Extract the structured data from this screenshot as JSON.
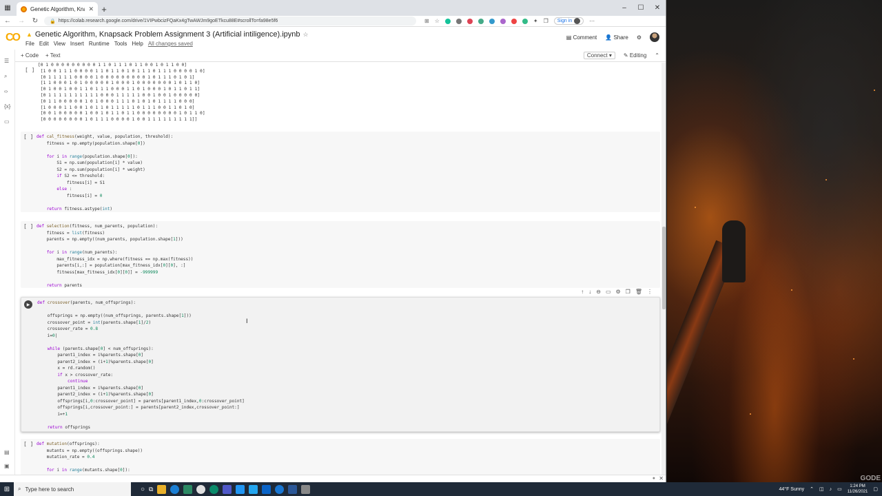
{
  "browser": {
    "tab_title": "Genetic Algorithm, Knapsack Pro",
    "url": "https://colab.research.google.com/drive/1VIPwbcizFQaKx4gTwAWJm9goETkcu88E#scrollTo=fa98e5f6",
    "signin_label": "Sign in"
  },
  "colab": {
    "logo": "CO",
    "notebook_title": "Genetic Algorithm, Knapsack Problem Assignment 3 (Artificial intiligence).ipynb",
    "menu": [
      "File",
      "Edit",
      "View",
      "Insert",
      "Runtime",
      "Tools",
      "Help"
    ],
    "saved_status": "All changes saved",
    "comment_label": "Comment",
    "share_label": "Share",
    "add_code_label": "+ Code",
    "add_text_label": "+ Text",
    "connect_label": "Connect",
    "editing_label": "Editing"
  },
  "cells": {
    "output_bracket": "[ ]",
    "output_text": "[0 1 0 0 0 0 0 0 0 0 0 1 1 0 1 1 1 0 1 1 0 0 1 0 1 1 0 0]\n [1 0 0 1 1 1 0 0 0 0 1 1 0 1 1 0 1 0 1 1 1 0 1 1 1 0 0 0 0 1 0]\n [0 1 1 1 1 1 0 0 0 0 1 0 0 0 0 0 0 0 0 0 1 0 1 1 1 0 1 0 1]\n [1 1 0 0 0 1 0 1 0 0 0 0 0 1 0 0 0 1 0 0 0 0 0 0 0 1 0 1 1 0]\n [0 1 0 0 1 0 0 1 1 0 1 1 1 0 0 0 1 1 0 1 0 0 0 1 0 1 1 0 1 1]\n [0 1 1 1 1 1 1 1 1 1 1 0 0 0 1 1 1 1 1 0 0 1 0 0 1 0 0 0 0 0]\n [0 1 1 0 0 0 0 0 1 0 1 0 0 0 1 1 1 0 1 0 1 0 1 1 1 1 0 0 0]\n [1 0 0 0 1 1 0 0 1 0 1 1 0 1 1 1 1 1 0 1 1 1 0 0 1 1 0 1 0]\n [0 0 1 0 0 0 0 0 1 0 0 1 0 1 1 0 1 1 0 0 0 0 0 0 0 0 1 0 1 1 0]\n [0 0 0 0 0 0 0 0 1 0 1 1 1 0 0 0 0 1 0 0 1 1 1 1 1 1 1 1 1]]",
    "fitness_bracket": "[ ]",
    "selection_bracket": "[ ]",
    "mutation_bracket": "[ ]",
    "toolbar_icons": [
      "up-arrow",
      "down-arrow",
      "link",
      "comment",
      "settings",
      "mirror",
      "delete",
      "more"
    ]
  },
  "taskbar": {
    "search_placeholder": "Type here to search",
    "weather": "44°F  Sunny",
    "time": "1:24 PM",
    "date": "11/26/2021"
  },
  "wallpaper": {
    "watermark": "GODE"
  }
}
